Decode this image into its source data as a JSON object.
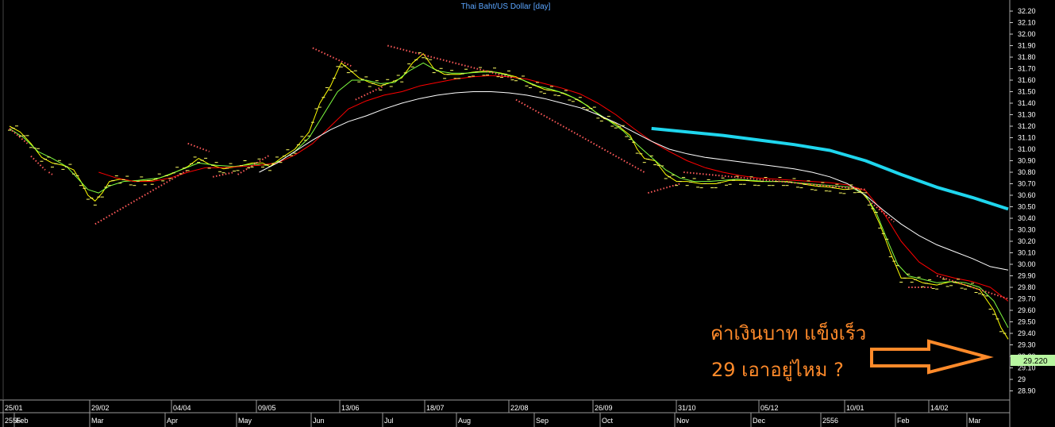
{
  "chart_data": {
    "type": "line",
    "title": "Thai Baht/US Dollar [day]",
    "ylim": [
      28.85,
      32.25
    ],
    "y_ticks": [
      "32.20",
      "32.10",
      "32.00",
      "31.90",
      "31.80",
      "31.70",
      "31.60",
      "31.50",
      "31.40",
      "31.30",
      "31.20",
      "31.10",
      "31.00",
      "30.90",
      "30.80",
      "30.70",
      "30.60",
      "30.50",
      "30.40",
      "30.30",
      "30.20",
      "30.10",
      "30.00",
      "29.90",
      "29.80",
      "29.70",
      "29.60",
      "29.50",
      "29.40",
      "29.30",
      "29.20",
      "29.10",
      "29",
      "28.90"
    ],
    "last_value": "29.220",
    "x_labels_top": [
      "25/01",
      "29/02",
      "04/04",
      "09/05",
      "13/06",
      "18/07",
      "22/08",
      "26/09",
      "31/10",
      "05/12",
      "10/01",
      "14/02"
    ],
    "x_labels_bottom": [
      "2555",
      "Feb",
      "Mar",
      "Apr",
      "May",
      "Jun",
      "Jul",
      "Aug",
      "Sep",
      "Oct",
      "Nov",
      "Dec",
      "2556",
      "Feb",
      "Mar"
    ],
    "x_index_range": [
      0,
      280
    ],
    "series": [
      {
        "values_xy": [
          [
            0,
            31.2
          ],
          [
            3,
            31.15
          ],
          [
            6,
            31.05
          ],
          [
            9,
            30.93
          ],
          [
            12,
            30.88
          ],
          [
            15,
            30.86
          ],
          [
            18,
            30.82
          ],
          [
            20,
            30.72
          ],
          [
            22,
            30.6
          ],
          [
            24,
            30.55
          ],
          [
            26,
            30.62
          ],
          [
            28,
            30.72
          ],
          [
            31,
            30.74
          ],
          [
            35,
            30.72
          ],
          [
            40,
            30.73
          ],
          [
            45,
            30.78
          ],
          [
            50,
            30.85
          ],
          [
            53,
            30.92
          ],
          [
            56,
            30.87
          ],
          [
            60,
            30.83
          ],
          [
            64,
            30.85
          ],
          [
            68,
            30.88
          ],
          [
            71,
            30.88
          ],
          [
            73,
            30.85
          ],
          [
            76,
            30.92
          ],
          [
            80,
            31.0
          ],
          [
            84,
            31.15
          ],
          [
            87,
            31.4
          ],
          [
            90,
            31.55
          ],
          [
            93,
            31.75
          ],
          [
            95,
            31.7
          ],
          [
            98,
            31.62
          ],
          [
            101,
            31.58
          ],
          [
            104,
            31.55
          ],
          [
            107,
            31.58
          ],
          [
            110,
            31.62
          ],
          [
            113,
            31.75
          ],
          [
            116,
            31.83
          ],
          [
            119,
            31.7
          ],
          [
            122,
            31.65
          ],
          [
            126,
            31.65
          ],
          [
            130,
            31.67
          ],
          [
            134,
            31.68
          ],
          [
            138,
            31.66
          ],
          [
            142,
            31.63
          ],
          [
            146,
            31.57
          ],
          [
            150,
            31.52
          ],
          [
            154,
            31.5
          ],
          [
            158,
            31.45
          ],
          [
            162,
            31.38
          ],
          [
            166,
            31.28
          ],
          [
            170,
            31.22
          ],
          [
            174,
            31.12
          ],
          [
            176,
            31.0
          ],
          [
            178,
            30.92
          ],
          [
            181,
            30.9
          ],
          [
            184,
            30.78
          ],
          [
            187,
            30.72
          ],
          [
            190,
            30.72
          ],
          [
            194,
            30.7
          ],
          [
            198,
            30.7
          ],
          [
            202,
            30.73
          ],
          [
            206,
            30.73
          ],
          [
            210,
            30.72
          ],
          [
            214,
            30.72
          ],
          [
            218,
            30.72
          ],
          [
            222,
            30.7
          ],
          [
            226,
            30.68
          ],
          [
            230,
            30.67
          ],
          [
            234,
            30.65
          ],
          [
            238,
            30.66
          ],
          [
            241,
            30.55
          ],
          [
            244,
            30.35
          ],
          [
            247,
            30.1
          ],
          [
            250,
            29.88
          ],
          [
            253,
            29.88
          ],
          [
            256,
            29.84
          ],
          [
            260,
            29.82
          ],
          [
            264,
            29.85
          ],
          [
            268,
            29.82
          ],
          [
            272,
            29.78
          ],
          [
            276,
            29.6
          ],
          [
            278,
            29.45
          ],
          [
            280,
            29.35
          ]
        ],
        "color": "#ffff00",
        "width": 1
      },
      {
        "values_xy": [
          [
            0,
            31.18
          ],
          [
            4,
            31.1
          ],
          [
            8,
            30.98
          ],
          [
            12,
            30.92
          ],
          [
            16,
            30.85
          ],
          [
            19,
            30.75
          ],
          [
            22,
            30.65
          ],
          [
            25,
            30.62
          ],
          [
            28,
            30.68
          ],
          [
            32,
            30.72
          ],
          [
            36,
            30.73
          ],
          [
            42,
            30.75
          ],
          [
            48,
            30.82
          ],
          [
            53,
            30.88
          ],
          [
            58,
            30.86
          ],
          [
            63,
            30.85
          ],
          [
            68,
            30.87
          ],
          [
            72,
            30.86
          ],
          [
            76,
            30.9
          ],
          [
            80,
            30.98
          ],
          [
            84,
            31.1
          ],
          [
            88,
            31.3
          ],
          [
            92,
            31.5
          ],
          [
            96,
            31.6
          ],
          [
            100,
            31.6
          ],
          [
            104,
            31.57
          ],
          [
            108,
            31.58
          ],
          [
            112,
            31.68
          ],
          [
            116,
            31.75
          ],
          [
            120,
            31.68
          ],
          [
            124,
            31.66
          ],
          [
            128,
            31.66
          ],
          [
            132,
            31.67
          ],
          [
            136,
            31.67
          ],
          [
            140,
            31.64
          ],
          [
            144,
            31.6
          ],
          [
            148,
            31.55
          ],
          [
            152,
            31.52
          ],
          [
            156,
            31.48
          ],
          [
            160,
            31.42
          ],
          [
            164,
            31.33
          ],
          [
            168,
            31.25
          ],
          [
            172,
            31.16
          ],
          [
            176,
            31.04
          ],
          [
            180,
            30.93
          ],
          [
            184,
            30.82
          ],
          [
            188,
            30.75
          ],
          [
            192,
            30.72
          ],
          [
            196,
            30.72
          ],
          [
            200,
            30.73
          ],
          [
            204,
            30.74
          ],
          [
            208,
            30.73
          ],
          [
            212,
            30.72
          ],
          [
            216,
            30.72
          ],
          [
            220,
            30.71
          ],
          [
            224,
            30.7
          ],
          [
            228,
            30.69
          ],
          [
            232,
            30.68
          ],
          [
            236,
            30.67
          ],
          [
            240,
            30.6
          ],
          [
            243,
            30.45
          ],
          [
            246,
            30.22
          ],
          [
            249,
            30.0
          ],
          [
            252,
            29.9
          ],
          [
            256,
            29.87
          ],
          [
            260,
            29.84
          ],
          [
            264,
            29.85
          ],
          [
            268,
            29.84
          ],
          [
            272,
            29.8
          ],
          [
            276,
            29.68
          ],
          [
            280,
            29.45
          ]
        ],
        "color": "#80ff40",
        "width": 1
      },
      {
        "values_xy": [
          [
            25,
            30.8
          ],
          [
            30,
            30.75
          ],
          [
            35,
            30.72
          ],
          [
            40,
            30.72
          ],
          [
            45,
            30.75
          ],
          [
            50,
            30.8
          ],
          [
            55,
            30.84
          ],
          [
            60,
            30.84
          ],
          [
            65,
            30.85
          ],
          [
            70,
            30.86
          ],
          [
            75,
            30.88
          ],
          [
            80,
            30.95
          ],
          [
            85,
            31.05
          ],
          [
            90,
            31.2
          ],
          [
            95,
            31.35
          ],
          [
            100,
            31.42
          ],
          [
            105,
            31.47
          ],
          [
            110,
            31.5
          ],
          [
            115,
            31.55
          ],
          [
            120,
            31.58
          ],
          [
            125,
            31.61
          ],
          [
            130,
            31.63
          ],
          [
            135,
            31.64
          ],
          [
            140,
            31.63
          ],
          [
            145,
            31.61
          ],
          [
            150,
            31.57
          ],
          [
            155,
            31.53
          ],
          [
            160,
            31.48
          ],
          [
            165,
            31.4
          ],
          [
            170,
            31.3
          ],
          [
            175,
            31.18
          ],
          [
            180,
            31.07
          ],
          [
            185,
            30.98
          ],
          [
            190,
            30.9
          ],
          [
            195,
            30.84
          ],
          [
            200,
            30.8
          ],
          [
            205,
            30.77
          ],
          [
            210,
            30.75
          ],
          [
            215,
            30.74
          ],
          [
            220,
            30.73
          ],
          [
            225,
            30.72
          ],
          [
            230,
            30.71
          ],
          [
            235,
            30.69
          ],
          [
            240,
            30.64
          ],
          [
            245,
            30.45
          ],
          [
            250,
            30.2
          ],
          [
            255,
            30.02
          ],
          [
            260,
            29.92
          ],
          [
            265,
            29.88
          ],
          [
            270,
            29.85
          ],
          [
            275,
            29.8
          ],
          [
            280,
            29.68
          ]
        ],
        "color": "#ff0000",
        "width": 1
      },
      {
        "values_xy": [
          [
            70,
            30.8
          ],
          [
            75,
            30.88
          ],
          [
            80,
            30.98
          ],
          [
            85,
            31.08
          ],
          [
            90,
            31.17
          ],
          [
            95,
            31.24
          ],
          [
            100,
            31.29
          ],
          [
            105,
            31.35
          ],
          [
            110,
            31.4
          ],
          [
            115,
            31.44
          ],
          [
            120,
            31.47
          ],
          [
            125,
            31.49
          ],
          [
            130,
            31.5
          ],
          [
            135,
            31.5
          ],
          [
            140,
            31.49
          ],
          [
            145,
            31.47
          ],
          [
            150,
            31.44
          ],
          [
            155,
            31.4
          ],
          [
            160,
            31.36
          ],
          [
            165,
            31.3
          ],
          [
            170,
            31.23
          ],
          [
            175,
            31.15
          ],
          [
            180,
            31.07
          ],
          [
            185,
            31.0
          ],
          [
            190,
            30.96
          ],
          [
            195,
            30.93
          ],
          [
            200,
            30.91
          ],
          [
            205,
            30.89
          ],
          [
            210,
            30.87
          ],
          [
            215,
            30.85
          ],
          [
            220,
            30.83
          ],
          [
            225,
            30.8
          ],
          [
            230,
            30.76
          ],
          [
            235,
            30.7
          ],
          [
            240,
            30.6
          ],
          [
            245,
            30.47
          ],
          [
            250,
            30.35
          ],
          [
            255,
            30.25
          ],
          [
            260,
            30.17
          ],
          [
            265,
            30.11
          ],
          [
            270,
            30.05
          ],
          [
            275,
            29.98
          ],
          [
            280,
            29.95
          ]
        ],
        "color": "#ffffff",
        "width": 1
      },
      {
        "values_xy": [
          [
            180,
            31.18
          ],
          [
            190,
            31.15
          ],
          [
            200,
            31.12
          ],
          [
            210,
            31.08
          ],
          [
            220,
            31.04
          ],
          [
            230,
            30.99
          ],
          [
            240,
            30.9
          ],
          [
            250,
            30.78
          ],
          [
            260,
            30.67
          ],
          [
            270,
            30.58
          ],
          [
            280,
            30.48
          ]
        ],
        "color": "#1fd6ee",
        "width": 4
      }
    ],
    "dotted_stops": [
      {
        "x": [
          0,
          5
        ],
        "y0": 31.18,
        "y1": 31.05
      },
      {
        "x": [
          6,
          10
        ],
        "y0": 30.94,
        "y1": 30.82
      },
      {
        "x": [
          11,
          12
        ],
        "y0": 30.8,
        "y1": 30.78
      },
      {
        "x": [
          24,
          50
        ],
        "y0": 30.35,
        "y1": 30.82
      },
      {
        "x": [
          50,
          56
        ],
        "y0": 31.05,
        "y1": 30.98
      },
      {
        "x": [
          57,
          63
        ],
        "y0": 30.76,
        "y1": 30.8
      },
      {
        "x": [
          64,
          73
        ],
        "y0": 30.78,
        "y1": 30.95
      },
      {
        "x": [
          85,
          96
        ],
        "y0": 31.88,
        "y1": 31.72
      },
      {
        "x": [
          97,
          105
        ],
        "y0": 31.43,
        "y1": 31.55
      },
      {
        "x": [
          106,
          141
        ],
        "y0": 31.9,
        "y1": 31.62
      },
      {
        "x": [
          142,
          178
        ],
        "y0": 31.43,
        "y1": 30.8
      },
      {
        "x": [
          179,
          188
        ],
        "y0": 30.62,
        "y1": 30.7
      },
      {
        "x": [
          189,
          240
        ],
        "y0": 30.8,
        "y1": 30.65
      },
      {
        "x": [
          241,
          248
        ],
        "y0": 30.55,
        "y1": 30.37
      },
      {
        "x": [
          252,
          259
        ],
        "y0": 29.8,
        "y1": 29.8
      },
      {
        "x": [
          260,
          280
        ],
        "y0": 29.9,
        "y1": 29.7
      }
    ],
    "annotation_line1": "ค่าเงินบาท แข็งเร็ว",
    "annotation_line2": "29 เอาอยู่ไหม ?",
    "annotation_color": "#ff8a2a",
    "price_box_color": "#b8f5a0"
  }
}
